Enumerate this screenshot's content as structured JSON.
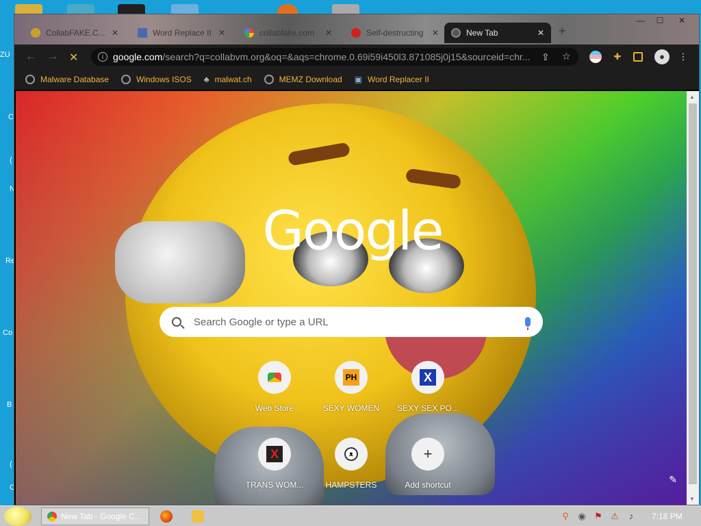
{
  "desktop": {
    "left_labels": [
      "ZU",
      "C",
      "(",
      "N",
      "Re",
      "Co",
      "B",
      "(",
      "C"
    ]
  },
  "tabs": [
    {
      "label": "CollabFAKE.C...",
      "favicon": "collabfake-icon",
      "active": false
    },
    {
      "label": "Word Replace II",
      "favicon": "word-replacer-icon",
      "active": false
    },
    {
      "label": "collabfake.com",
      "favicon": "google-icon",
      "active": false
    },
    {
      "label": "Self-destructing",
      "favicon": "opera-icon",
      "active": false
    },
    {
      "label": "New Tab",
      "favicon": "chrome-icon",
      "active": true
    }
  ],
  "window_controls": {
    "minimize": "—",
    "maximize": "☐",
    "close": "✕"
  },
  "toolbar": {
    "back": "←",
    "forward": "→",
    "reload": "✕",
    "url_domain": "google.com",
    "url_rest": "/search?q=collabvm.org&oq=&aqs=chrome.0.69i59i450l3.871085j0j15&sourceid=chr...",
    "info_glyph": "i"
  },
  "bookmarks": [
    {
      "label": "Malware Database",
      "icon": "globe-icon"
    },
    {
      "label": "Windows ISOS",
      "icon": "globe-icon"
    },
    {
      "label": "malwat.ch",
      "icon": "malwatch-icon"
    },
    {
      "label": "MEMZ Download",
      "icon": "globe-icon"
    },
    {
      "label": "Word Replacer II",
      "icon": "word-replacer-icon"
    }
  ],
  "ntp": {
    "logo": "Google",
    "search_placeholder": "Search Google or type a URL",
    "shortcuts": [
      {
        "label": "Web Store",
        "icon": "web-store-icon"
      },
      {
        "label": "SEXY WOMEN",
        "icon": "ph-icon",
        "glyph": "PH"
      },
      {
        "label": "SEXY SEX PO...",
        "icon": "x-blue-icon",
        "glyph": "X"
      },
      {
        "label": "TRANS WOM...",
        "icon": "x-red-icon",
        "glyph": "X"
      },
      {
        "label": "HAMPSTERS",
        "icon": "hamster-icon"
      },
      {
        "label": "Add shortcut",
        "icon": "plus-icon",
        "glyph": "+"
      }
    ],
    "customize_glyph": "✎"
  },
  "taskbar": {
    "task_label": "New Tab - Google C...",
    "clock": "7:18 PM"
  },
  "colors": {
    "bookmark_text": "#f2b53c",
    "desktop_bg": "#1aa0d8"
  }
}
